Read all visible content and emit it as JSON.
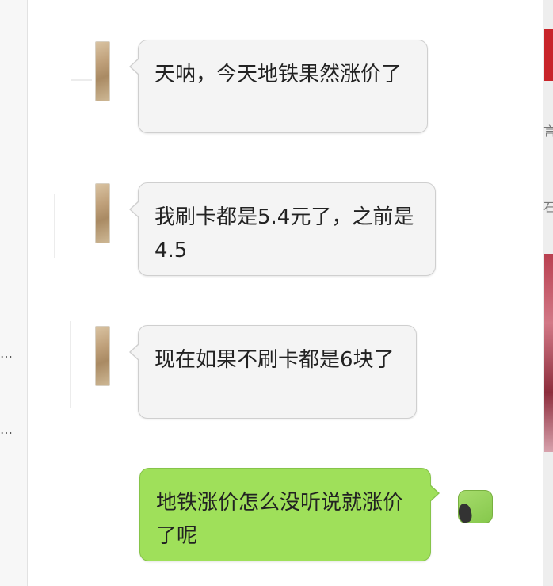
{
  "left_pane": {
    "truncated_items": [
      "…",
      "…"
    ]
  },
  "right_pane": {
    "fragments": [
      "言",
      "石"
    ]
  },
  "messages": [
    {
      "direction": "incoming",
      "text": "天呐，今天地铁果然涨价了"
    },
    {
      "direction": "incoming",
      "text": "我刷卡都是5.4元了，之前是4.5"
    },
    {
      "direction": "incoming",
      "text": "现在如果不刷卡都是6块了"
    },
    {
      "direction": "outgoing",
      "text": "地铁涨价怎么没听说就涨价了呢"
    }
  ],
  "colors": {
    "incoming_bubble": "#f4f4f4",
    "outgoing_bubble": "#9fe05a",
    "background": "#ffffff"
  }
}
